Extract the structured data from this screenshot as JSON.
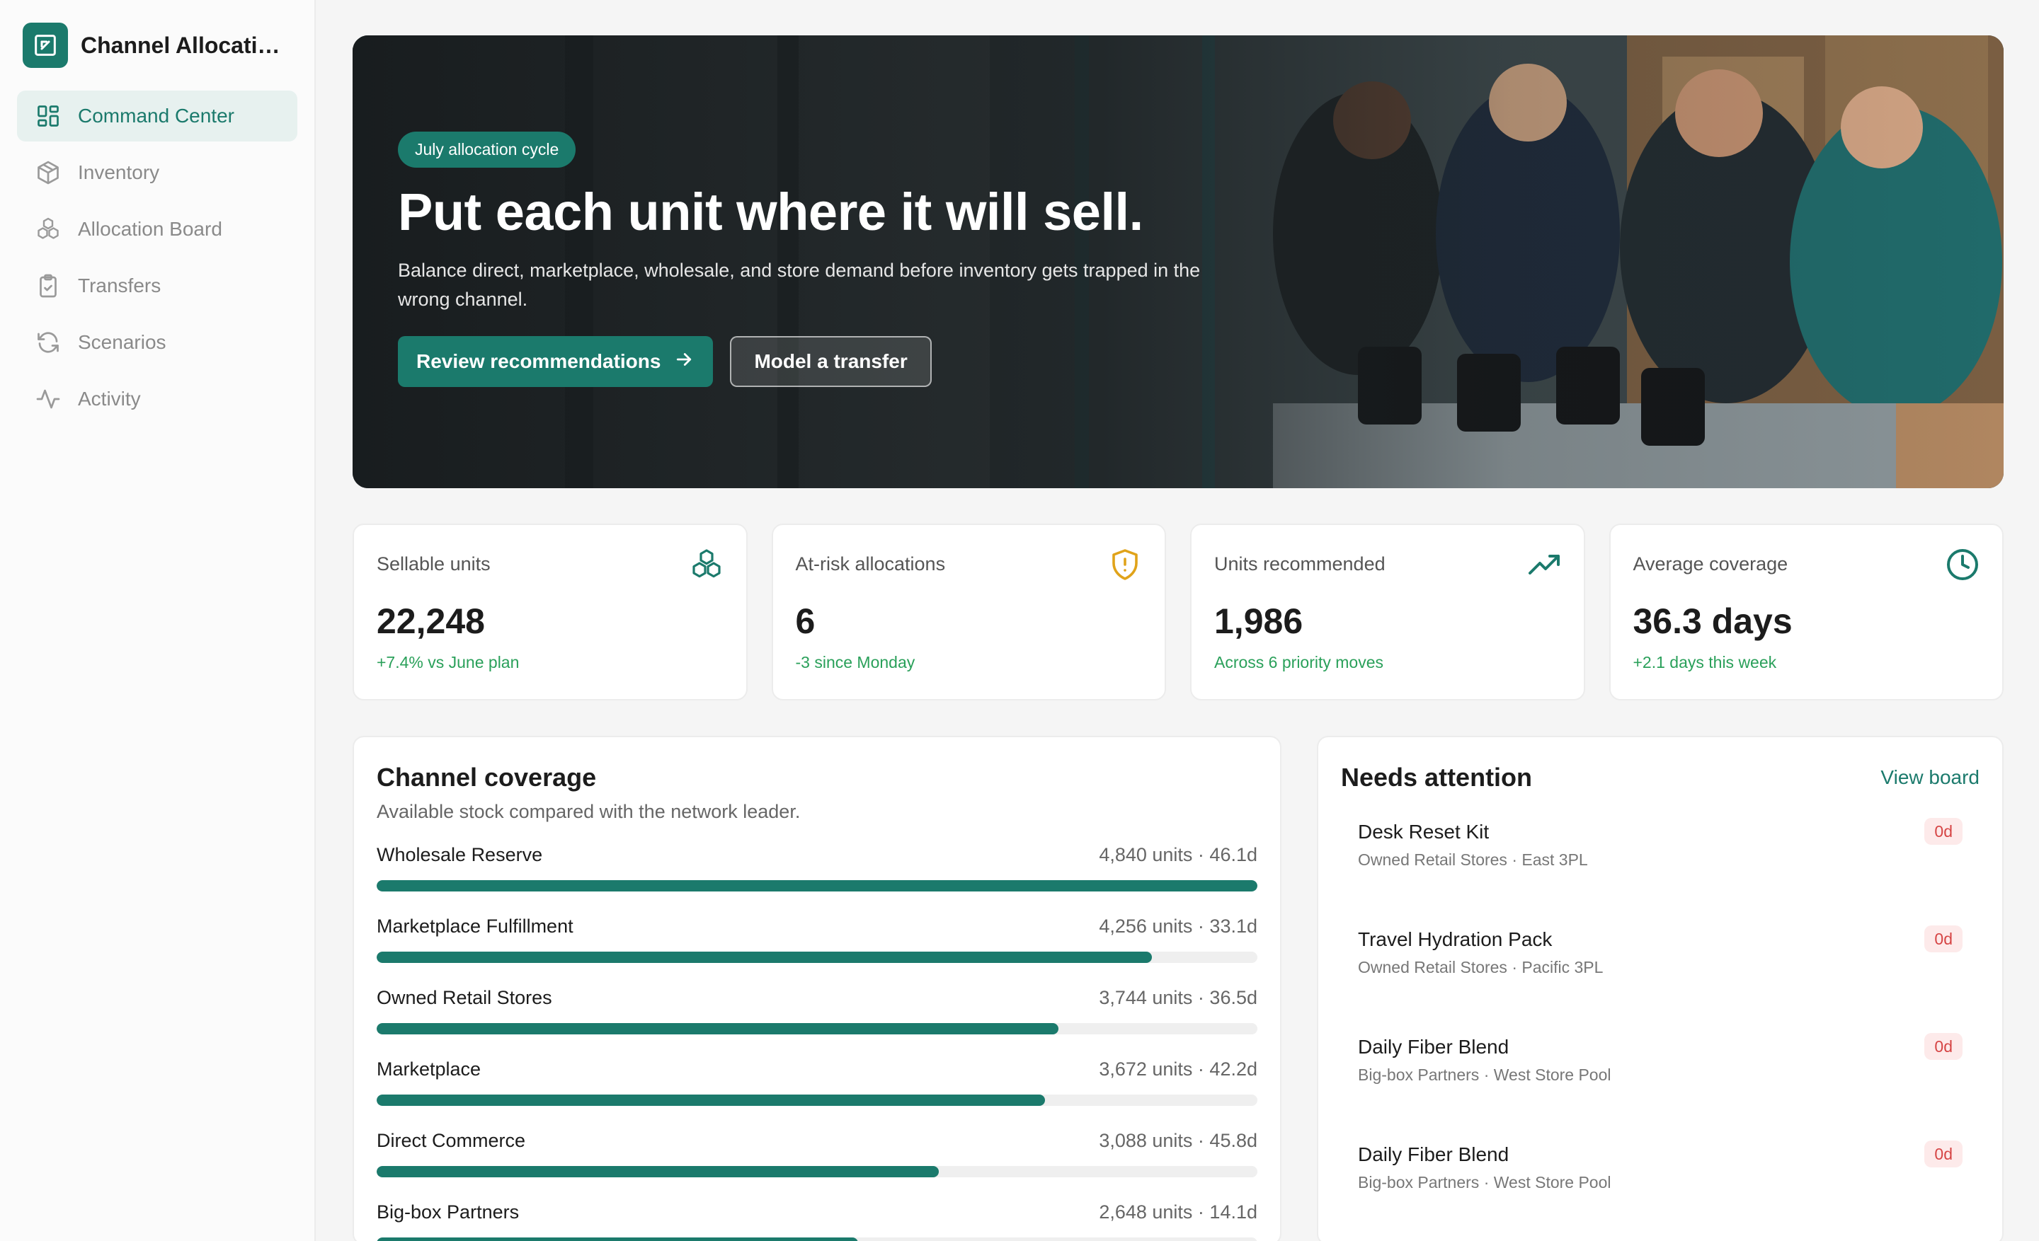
{
  "app": {
    "title": "Channel Allocation Studio"
  },
  "sidebar": {
    "items": [
      {
        "label": "Command Center",
        "icon": "dashboard-icon",
        "active": true
      },
      {
        "label": "Inventory",
        "icon": "package-icon"
      },
      {
        "label": "Allocation Board",
        "icon": "boxes-icon"
      },
      {
        "label": "Transfers",
        "icon": "clipboard-icon"
      },
      {
        "label": "Scenarios",
        "icon": "refresh-icon"
      },
      {
        "label": "Activity",
        "icon": "activity-icon"
      }
    ]
  },
  "hero": {
    "badge": "July allocation cycle",
    "title": "Put each unit where it will sell.",
    "subtitle": "Balance direct, marketplace, wholesale, and store demand before inventory gets trapped in the wrong channel.",
    "primary_label": "Review recommendations",
    "secondary_label": "Model a transfer"
  },
  "stats": [
    {
      "label": "Sellable units",
      "value": "22,248",
      "delta": "+7.4% vs June plan",
      "icon": "boxes-icon",
      "icon_color": "#1b7a6c"
    },
    {
      "label": "At-risk allocations",
      "value": "6",
      "delta": "-3 since Monday",
      "icon": "shield-alert-icon",
      "icon_color": "#e0a31a"
    },
    {
      "label": "Units recommended",
      "value": "1,986",
      "delta": "Across 6 priority moves",
      "icon": "trending-up-icon",
      "icon_color": "#1b7a6c"
    },
    {
      "label": "Average coverage",
      "value": "36.3 days",
      "delta": "+2.1 days this week",
      "icon": "clock-icon",
      "icon_color": "#1b7a6c"
    }
  ],
  "coverage": {
    "title": "Channel coverage",
    "subtitle": "Available stock compared with the network leader.",
    "rows": [
      {
        "name": "Wholesale Reserve",
        "meta": "4,840 units · 46.1d",
        "pct": 100
      },
      {
        "name": "Marketplace Fulfillment",
        "meta": "4,256 units · 33.1d",
        "pct": 88
      },
      {
        "name": "Owned Retail Stores",
        "meta": "3,744 units · 36.5d",
        "pct": 77.4
      },
      {
        "name": "Marketplace",
        "meta": "3,672 units · 42.2d",
        "pct": 75.9
      },
      {
        "name": "Direct Commerce",
        "meta": "3,088 units · 45.8d",
        "pct": 63.8
      },
      {
        "name": "Big-box Partners",
        "meta": "2,648 units · 14.1d",
        "pct": 54.7
      }
    ]
  },
  "attention": {
    "title": "Needs attention",
    "link": "View board",
    "items": [
      {
        "title": "Desk Reset Kit",
        "sub": "Owned Retail Stores · East 3PL",
        "badge": "0d"
      },
      {
        "title": "Travel Hydration Pack",
        "sub": "Owned Retail Stores · Pacific 3PL",
        "badge": "0d"
      },
      {
        "title": "Daily Fiber Blend",
        "sub": "Big-box Partners · West Store Pool",
        "badge": "0d"
      },
      {
        "title": "Daily Fiber Blend",
        "sub": "Big-box Partners · West Store Pool",
        "badge": "0d"
      }
    ]
  }
}
